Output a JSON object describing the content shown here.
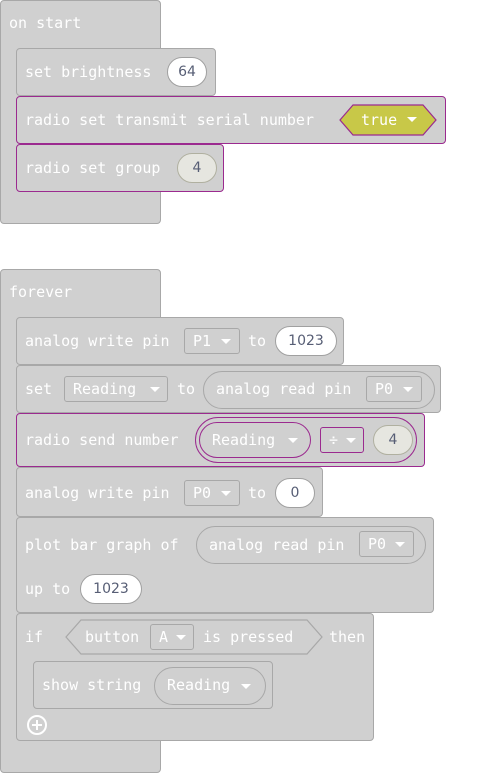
{
  "on_start": {
    "hat_label": "on start",
    "set_brightness": {
      "label": "set brightness",
      "value": "64"
    },
    "radio_set_transmit": {
      "label": "radio set transmit serial number",
      "value": "true"
    },
    "radio_set_group": {
      "label": "radio set group",
      "value": "4"
    }
  },
  "forever": {
    "hat_label": "forever",
    "analog_write_1": {
      "label": "analog write pin",
      "pin": "P1",
      "to_label": "to",
      "value": "1023"
    },
    "set_reading": {
      "set_label": "set",
      "variable": "Reading",
      "to_label": "to",
      "reporter_label": "analog read pin",
      "pin": "P0"
    },
    "radio_send": {
      "label": "radio send number",
      "variable": "Reading",
      "operator": "÷",
      "value": "4"
    },
    "analog_write_2": {
      "label": "analog write pin",
      "pin": "P0",
      "to_label": "to",
      "value": "0"
    },
    "plot_bar": {
      "label": "plot bar graph of",
      "reporter_label": "analog read pin",
      "pin": "P0",
      "up_to_label": "up to",
      "value": "1023"
    },
    "if_block": {
      "if_label": "if",
      "condition_label_1": "button",
      "button": "A",
      "condition_label_2": "is pressed",
      "then_label": "then",
      "show_string": {
        "label": "show string",
        "variable": "Reading"
      }
    }
  },
  "colors": {
    "block_gray": "#d0d0d0",
    "radio_hatch_base": "#c8c848",
    "radio_border": "#9b2a8f",
    "text": "#ffffff"
  }
}
